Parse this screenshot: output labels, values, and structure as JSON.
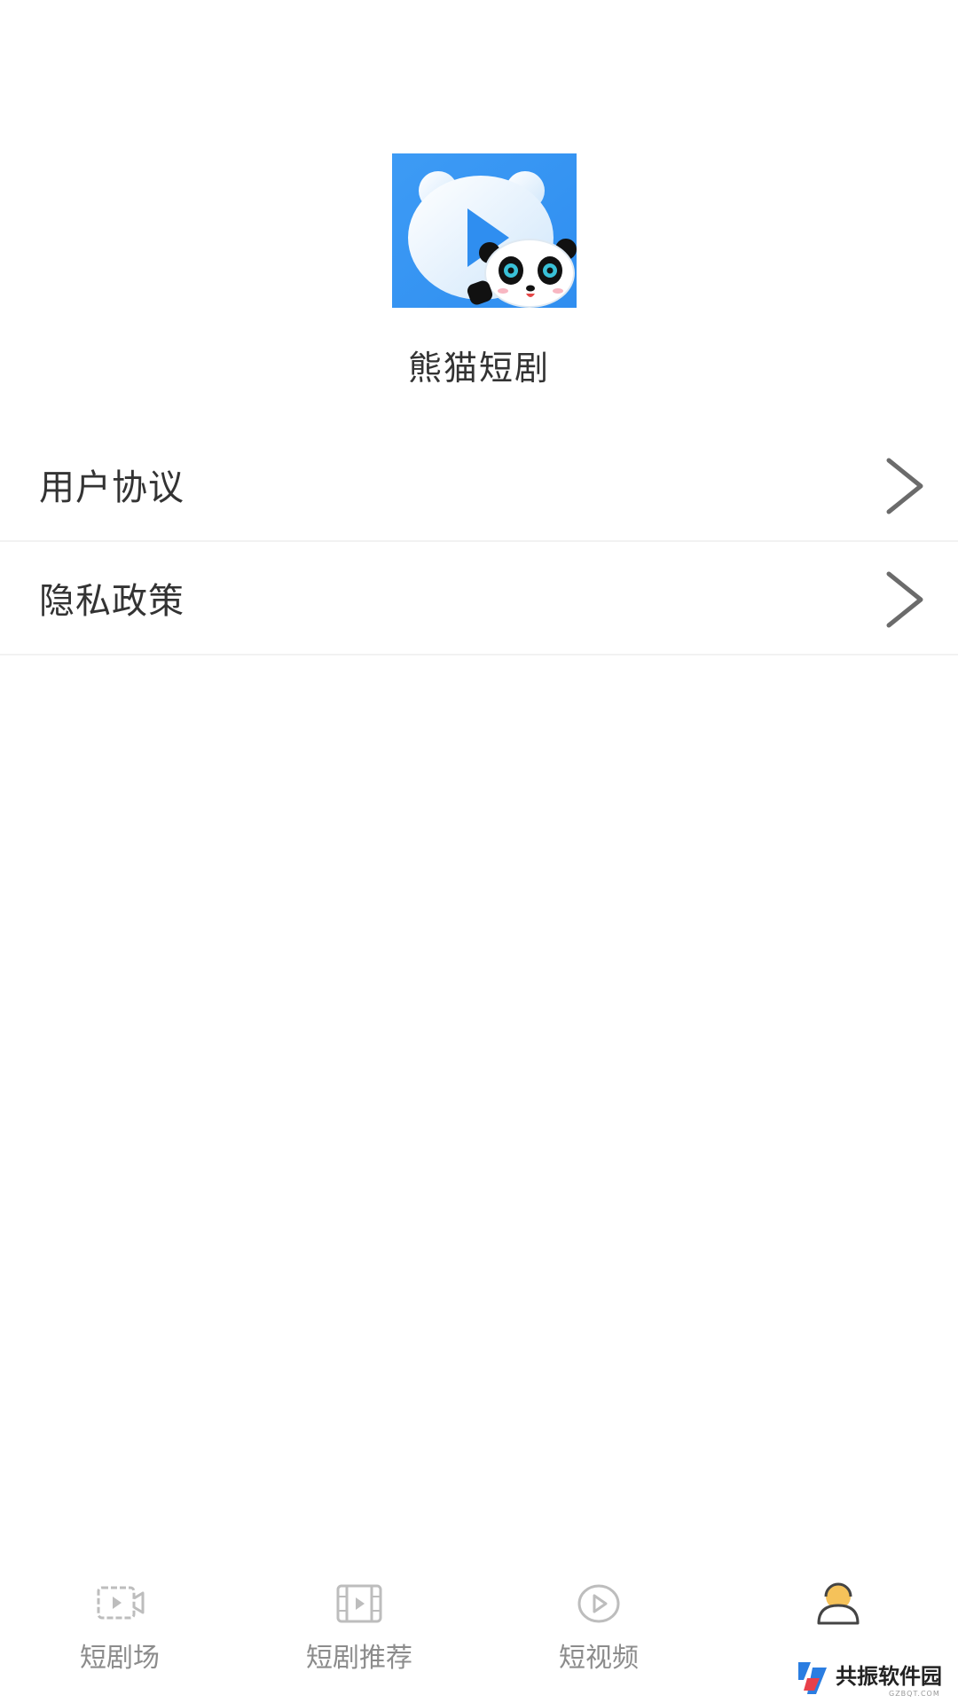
{
  "app": {
    "name": "熊猫短剧",
    "logo_icon": "panda-play-logo",
    "brand_color": "#3d9bf5"
  },
  "menu": {
    "items": [
      {
        "label": "用户协议",
        "icon": "chevron-right-icon"
      },
      {
        "label": "隐私政策",
        "icon": "chevron-right-icon"
      }
    ]
  },
  "tabbar": {
    "tabs": [
      {
        "label": "短剧场",
        "icon": "video-icon",
        "active": false
      },
      {
        "label": "短剧推荐",
        "icon": "film-icon",
        "active": false
      },
      {
        "label": "短视频",
        "icon": "play-circle-icon",
        "active": false
      },
      {
        "label": "",
        "icon": "user-icon",
        "active": true
      }
    ],
    "inactive_color": "#8c8c8c",
    "active_color": "#f5c25a"
  },
  "watermark": {
    "text": "共振软件园",
    "sub": "GZBQT.COM"
  }
}
